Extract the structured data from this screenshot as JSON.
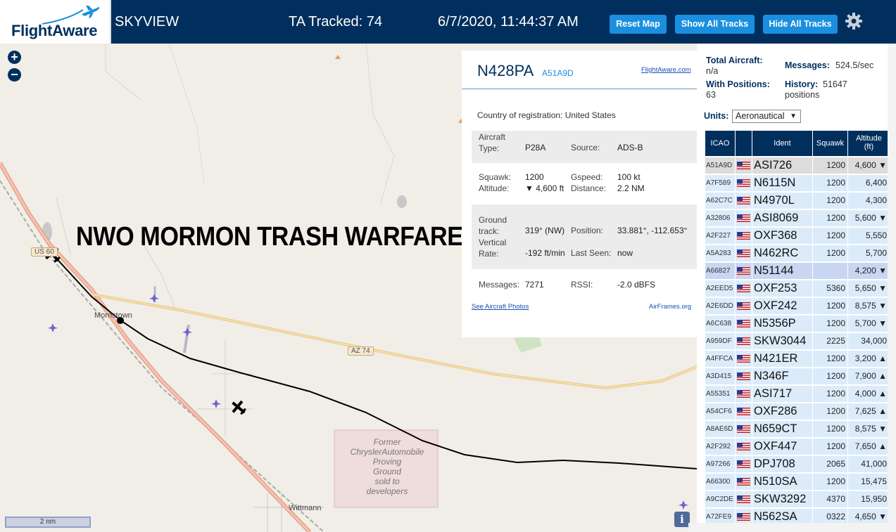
{
  "header": {
    "logo_text": "FlightAware",
    "app_title": "SKYVIEW",
    "tracked": "TA Tracked: 74",
    "datetime": "6/7/2020, 11:44:37 AM",
    "reset_map": "Reset Map",
    "show_all": "Show All Tracks",
    "hide_all": "Hide All Tracks"
  },
  "map": {
    "zoom_in": "+",
    "zoom_out": "−",
    "scale": "2 nm",
    "info": "i",
    "labels": {
      "us60": "US 60",
      "morristown": "Morristown",
      "az74": "AZ 74",
      "wittmann": "Wittmann",
      "former": [
        "Former",
        "ChryslerAutomobile",
        "Proving",
        "Ground",
        "sold to",
        "developers"
      ]
    },
    "overlay_text": "NWO MORMON TRASH WARFARE"
  },
  "popup": {
    "registration": "N428PA",
    "hex": "A51A9D",
    "fa_link": "FlightAware.com",
    "country_label": "Country of registration:",
    "country_value": "United States",
    "aircraft_type_label": [
      "Aircraft",
      "Type:"
    ],
    "aircraft_type": "P28A",
    "source_label": "Source:",
    "source": "ADS-B",
    "squawk_label": "Squawk:",
    "squawk": "1200",
    "gspeed_label": "Gspeed:",
    "gspeed": "100 kt",
    "altitude_label": "Altitude:",
    "altitude": "▼ 4,600 ft",
    "distance_label": "Distance:",
    "distance": "2.2 NM",
    "ground_track_label": [
      "Ground",
      "track:"
    ],
    "ground_track": "319° (NW)",
    "position_label": "Position:",
    "position": "33.881°, -112.653°",
    "vrate_label": [
      "Vertical",
      "Rate:"
    ],
    "vrate": "-192 ft/min",
    "last_seen_label": "Last Seen:",
    "last_seen": "now",
    "messages_label": "Messages:",
    "messages": "7271",
    "rssi_label": "RSSI:",
    "rssi": "-2.0 dBFS",
    "see_photos": "See Aircraft Photos",
    "airframes": "AirFrames.org"
  },
  "sidebar": {
    "total_label": "Total Aircraft:",
    "total_value": "n/a",
    "messages_label": "Messages:",
    "messages_value": "524.5/sec",
    "with_pos_label": "With Positions:",
    "with_pos_value": "63",
    "history_label": "History:",
    "history_value": "51647",
    "history_unit": "positions",
    "units_label": "Units:",
    "units_value": "Aeronautical",
    "columns": {
      "icao": "ICAO",
      "ident": "Ident",
      "squawk": "Squawk",
      "altitude": "Altitude",
      "altitude_unit": "(ft)"
    },
    "rows": [
      {
        "icao": "A51A9D",
        "ident": "ASI726",
        "squawk": "1200",
        "alt": "4,600 ▼"
      },
      {
        "icao": "A7F589",
        "ident": "N6115N",
        "squawk": "1200",
        "alt": "6,400"
      },
      {
        "icao": "A62C7C",
        "ident": "N4970L",
        "squawk": "1200",
        "alt": "4,300"
      },
      {
        "icao": "A32806",
        "ident": "ASI8069",
        "squawk": "1200",
        "alt": "5,600 ▼"
      },
      {
        "icao": "A2F227",
        "ident": "OXF368",
        "squawk": "1200",
        "alt": "5,550"
      },
      {
        "icao": "A5A283",
        "ident": "N462RC",
        "squawk": "1200",
        "alt": "5,700"
      },
      {
        "icao": "A66827",
        "ident": "N51144",
        "squawk": "",
        "alt": "4,200 ▼"
      },
      {
        "icao": "A2EED5",
        "ident": "OXF253",
        "squawk": "5360",
        "alt": "5,650 ▼"
      },
      {
        "icao": "A2E6DD",
        "ident": "OXF242",
        "squawk": "1200",
        "alt": "8,575 ▼"
      },
      {
        "icao": "A6C638",
        "ident": "N5356P",
        "squawk": "1200",
        "alt": "5,700 ▼"
      },
      {
        "icao": "A959DF",
        "ident": "SKW3044",
        "squawk": "2225",
        "alt": "34,000"
      },
      {
        "icao": "A4FFCA",
        "ident": "N421ER",
        "squawk": "1200",
        "alt": "3,200 ▲"
      },
      {
        "icao": "A3D415",
        "ident": "N346F",
        "squawk": "1200",
        "alt": "7,900 ▲"
      },
      {
        "icao": "A55351",
        "ident": "ASI717",
        "squawk": "1200",
        "alt": "4,000 ▲"
      },
      {
        "icao": "A54CF6",
        "ident": "OXF286",
        "squawk": "1200",
        "alt": "7,625 ▲"
      },
      {
        "icao": "A8AE6D",
        "ident": "N659CT",
        "squawk": "1200",
        "alt": "8,575 ▼"
      },
      {
        "icao": "A2F292",
        "ident": "OXF447",
        "squawk": "1200",
        "alt": "7,650 ▲"
      },
      {
        "icao": "A97266",
        "ident": "DPJ708",
        "squawk": "2065",
        "alt": "41,000"
      },
      {
        "icao": "A66300",
        "ident": "N510SA",
        "squawk": "1200",
        "alt": "15,475"
      },
      {
        "icao": "A9C2DE",
        "ident": "SKW3292",
        "squawk": "4370",
        "alt": "15,950"
      },
      {
        "icao": "A72FE9",
        "ident": "N562SA",
        "squawk": "0322",
        "alt": "4,650 ▼"
      }
    ]
  },
  "colors": {
    "header_bg": "#002f5d",
    "button": "#1a8fe0",
    "row_bg": "#dcebfa",
    "selected_row": "#dcdcdc",
    "highlight_row": "#c9d6f2"
  }
}
